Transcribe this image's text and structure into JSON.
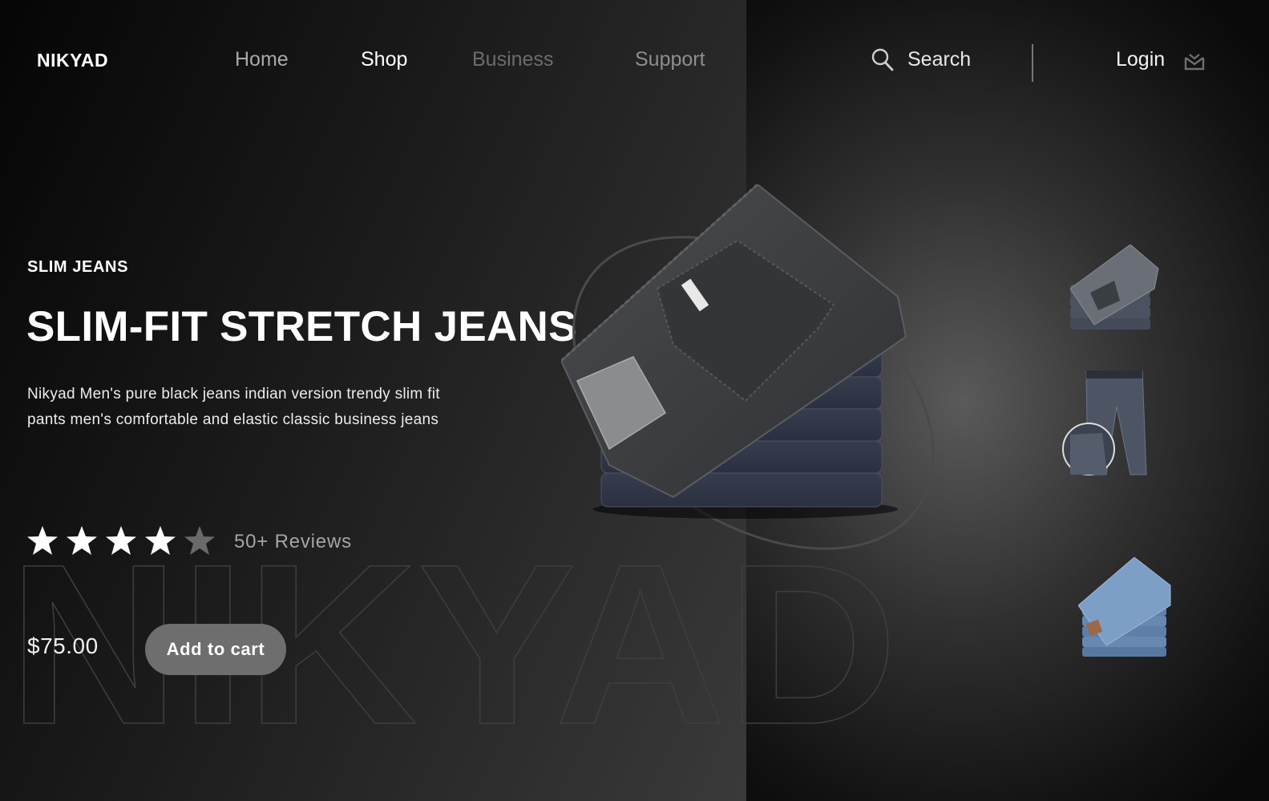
{
  "brand": "NIKYAD",
  "nav": {
    "home": "Home",
    "shop": "Shop",
    "business": "Business",
    "support": "Support"
  },
  "header": {
    "search_label": "Search",
    "login_label": "Login"
  },
  "product": {
    "category": "SLIM JEANS",
    "title": "SLIM-FIT STRETCH JEANS",
    "description": "Nikyad Men's pure black jeans indian version trendy slim fit pants men's comfortable and elastic classic business jeans",
    "rating": 4,
    "rating_max": 5,
    "reviews": "50+ Reviews",
    "price": "$75.00",
    "cart_label": "Add to cart"
  },
  "watermark_text": "NIKYAD",
  "icons": {
    "search": "search-icon",
    "mail": "mail-icon",
    "star": "star-icon"
  },
  "colors": {
    "button_bg": "#6e6e6e",
    "accent_text": "#ffffff",
    "muted_text": "#a5a5a5",
    "denim_dark": "#3a4150",
    "denim_light": "#6f8fb3"
  }
}
